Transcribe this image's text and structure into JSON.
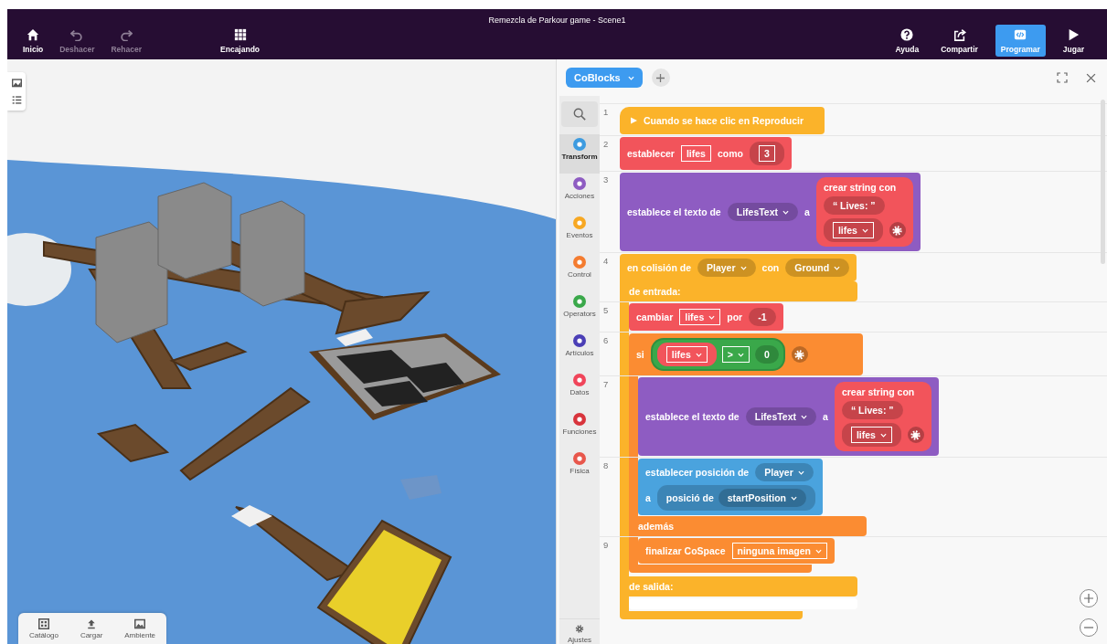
{
  "window": {
    "title": "Remezcla de Parkour game - Scene1"
  },
  "toolbar_left": [
    {
      "kind": "home",
      "label": "Inicio",
      "disabled": false
    },
    {
      "kind": "undo",
      "label": "Deshacer",
      "disabled": true
    },
    {
      "kind": "redo",
      "label": "Rehacer",
      "disabled": true
    },
    {
      "kind": "grid",
      "label": "Encajando",
      "disabled": false
    }
  ],
  "toolbar_right": [
    {
      "kind": "help",
      "label": "Ayuda",
      "selected": false
    },
    {
      "kind": "share",
      "label": "Compartir",
      "selected": false
    },
    {
      "kind": "code",
      "label": "Programar",
      "selected": true
    },
    {
      "kind": "play",
      "label": "Jugar",
      "selected": false
    }
  ],
  "scene_tabs": [
    {
      "kind": "catalog",
      "label": "Catálogo"
    },
    {
      "kind": "upload",
      "label": "Cargar"
    },
    {
      "kind": "environment",
      "label": "Ambiente"
    }
  ],
  "code_panel": {
    "tab": {
      "label": "CoBlocks"
    },
    "categories": [
      {
        "label": "Transform",
        "color": "#3d9be0",
        "selected": true
      },
      {
        "label": "Acciones",
        "color": "#8e5cc2",
        "selected": false
      },
      {
        "label": "Eventos",
        "color": "#f7a823",
        "selected": false
      },
      {
        "label": "Control",
        "color": "#f47c30",
        "selected": false
      },
      {
        "label": "Operators",
        "color": "#3aa84a",
        "selected": false
      },
      {
        "label": "Artículos",
        "color": "#4b3fb6",
        "selected": false
      },
      {
        "label": "Datos",
        "color": "#f0455a",
        "selected": false
      },
      {
        "label": "Funciones",
        "color": "#d8343c",
        "selected": false
      },
      {
        "label": "Física",
        "color": "#e8574c",
        "selected": false
      }
    ],
    "settings": {
      "label": "Ajustes"
    },
    "blocks": [
      {
        "line": "1",
        "kind": "hat",
        "color": "#fbb32a",
        "lines": [
          [
            {
              "kind": "play"
            },
            {
              "kind": "text",
              "text": "Cuando se hace clic en Reproducir"
            }
          ]
        ]
      },
      {
        "line": "2",
        "kind": "statement",
        "color": "#f2545b",
        "lines": [
          [
            {
              "kind": "text",
              "text": "establecer"
            },
            {
              "kind": "field",
              "text": "lifes"
            },
            {
              "kind": "text",
              "text": "como"
            },
            {
              "kind": "roundfield",
              "text": "3"
            }
          ]
        ]
      },
      {
        "line": "3",
        "kind": "statement",
        "color": "#8e5cc2",
        "lines": [
          [
            {
              "kind": "text",
              "text": "establece el texto de"
            },
            {
              "kind": "dropdown",
              "text": "LifesText"
            },
            {
              "kind": "text",
              "text": "a"
            },
            {
              "kind": "stack",
              "color": "#f2545b",
              "title": "crear string con",
              "items": [
                [
                  {
                    "kind": "round",
                    "text": "“ Lives: ”"
                  }
                ],
                [
                  {
                    "kind": "roundbox",
                    "text": "lifes"
                  },
                  {
                    "kind": "gear"
                  }
                ]
              ]
            }
          ]
        ]
      },
      {
        "line": "4",
        "kind": "cblock",
        "color": "#fbb32a",
        "lines": [
          [
            {
              "kind": "text",
              "text": "en colisión de"
            },
            {
              "kind": "dropdown",
              "text": "Player"
            },
            {
              "kind": "text",
              "text": "con"
            },
            {
              "kind": "dropdown",
              "text": "Ground"
            }
          ]
        ],
        "sections": [
          {
            "label": "de entrada:",
            "children": [
              {
                "line": "5",
                "kind": "statement",
                "color": "#f2545b",
                "lines": [
                  [
                    {
                      "kind": "text",
                      "text": "cambiar"
                    },
                    {
                      "kind": "boxdrop",
                      "text": "lifes"
                    },
                    {
                      "kind": "text",
                      "text": "por"
                    },
                    {
                      "kind": "round",
                      "text": "-1"
                    }
                  ]
                ]
              },
              {
                "line": "6",
                "kind": "cblock",
                "color": "#fb8c32",
                "lines": [
                  [
                    {
                      "kind": "text",
                      "text": "si"
                    },
                    {
                      "kind": "condition",
                      "color": "#3aa84a",
                      "items": [
                        {
                          "kind": "colorbox",
                          "color": "#f2545b",
                          "text": "lifes"
                        },
                        {
                          "kind": "boxdrop",
                          "text": ">"
                        },
                        {
                          "kind": "round",
                          "text": "0"
                        }
                      ]
                    },
                    {
                      "kind": "gear"
                    }
                  ]
                ],
                "sections": [
                  {
                    "children": [
                      {
                        "line": "7",
                        "kind": "statement",
                        "color": "#8e5cc2",
                        "lines": [
                          [
                            {
                              "kind": "text",
                              "text": "establece el texto de"
                            },
                            {
                              "kind": "dropdown",
                              "text": "LifesText"
                            },
                            {
                              "kind": "text",
                              "text": "a"
                            },
                            {
                              "kind": "stack",
                              "color": "#f2545b",
                              "title": "crear string con",
                              "items": [
                                [
                                  {
                                    "kind": "round",
                                    "text": "“ Lives: ”"
                                  }
                                ],
                                [
                                  {
                                    "kind": "roundbox",
                                    "text": "lifes"
                                  },
                                  {
                                    "kind": "gear"
                                  }
                                ]
                              ]
                            }
                          ]
                        ]
                      },
                      {
                        "line": "8",
                        "kind": "statement",
                        "color": "#4aa3de",
                        "lines": [
                          [
                            {
                              "kind": "text",
                              "text": "establecer posición de"
                            },
                            {
                              "kind": "dropdown",
                              "text": "Player"
                            }
                          ],
                          [
                            {
                              "kind": "text",
                              "text": "a"
                            },
                            {
                              "kind": "group",
                              "items": [
                                {
                                  "kind": "text",
                                  "text": "posició de"
                                },
                                {
                                  "kind": "dropdown",
                                  "text": "startPosition"
                                }
                              ]
                            }
                          ]
                        ]
                      }
                    ]
                  },
                  {
                    "label": "además",
                    "children": [
                      {
                        "line": "9",
                        "kind": "statement",
                        "color": "#fb8c32",
                        "lines": [
                          [
                            {
                              "kind": "text",
                              "text": "finalizar CoSpace"
                            },
                            {
                              "kind": "boxdrop",
                              "text": "ninguna imagen"
                            }
                          ]
                        ]
                      }
                    ]
                  }
                ]
              }
            ]
          },
          {
            "label": "de salida:"
          }
        ]
      }
    ]
  }
}
